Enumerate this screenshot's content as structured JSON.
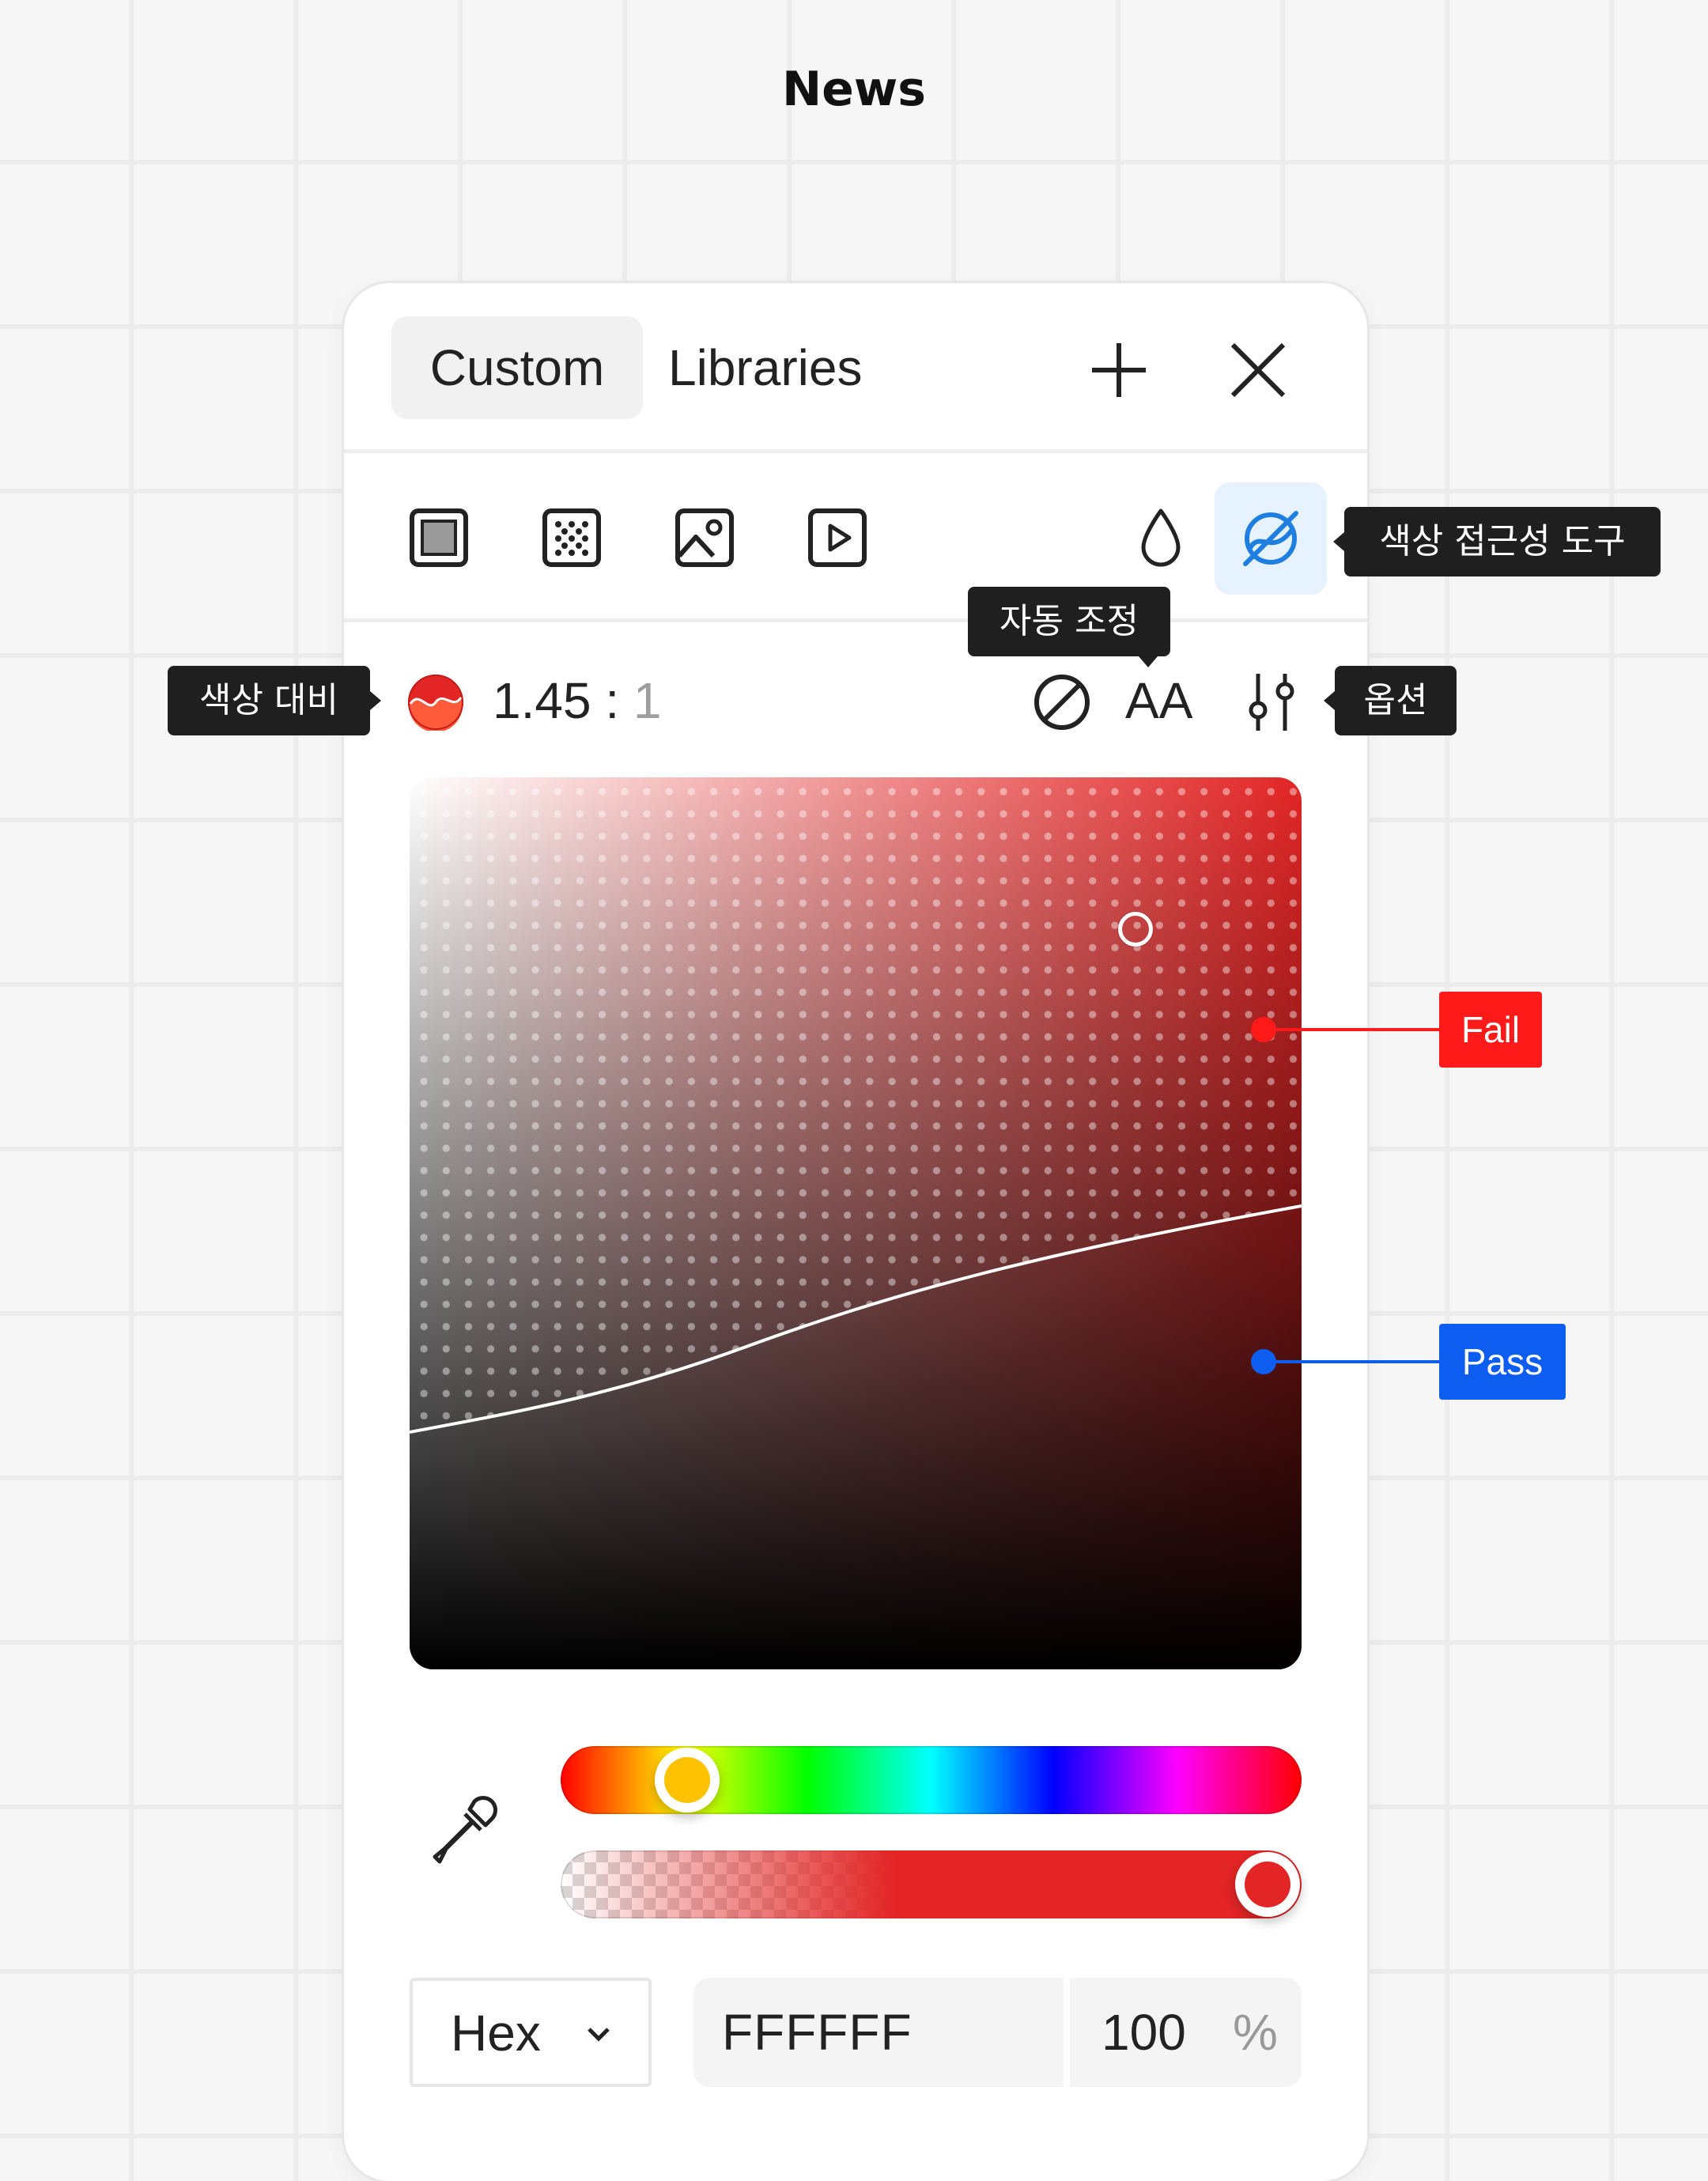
{
  "page": {
    "title": "News"
  },
  "picker": {
    "tabs": [
      {
        "label": "Custom",
        "active": true
      },
      {
        "label": "Libraries",
        "active": false
      }
    ],
    "header_icons": [
      "plus-icon",
      "close-icon"
    ],
    "fill_types": [
      "solid-fill-icon",
      "gradient-fill-icon",
      "image-fill-icon",
      "video-fill-icon"
    ],
    "tool_icons": [
      "droplet-icon",
      "color-accessibility-icon"
    ],
    "contrast": {
      "ratio": "1.45",
      "separator": ":",
      "base": "1",
      "level": "AA"
    },
    "tooltips": {
      "accessibility_tools": "색상 접근성 도구",
      "auto_adjust": "자동 조정",
      "color_contrast": "색상 대비",
      "options": "옵션"
    },
    "labels": {
      "fail": "Fail",
      "pass": "Pass"
    },
    "colors": {
      "current": "#e32525",
      "fail": "#ff1a1a",
      "pass": "#0d5ef0",
      "accent_bg": "#e6f2fd"
    },
    "sliders": {
      "hue_position": 0.17,
      "alpha_position": 0.95
    },
    "format": {
      "mode": "Hex",
      "value": "FFFFFF",
      "alpha": "100",
      "unit": "%"
    }
  }
}
